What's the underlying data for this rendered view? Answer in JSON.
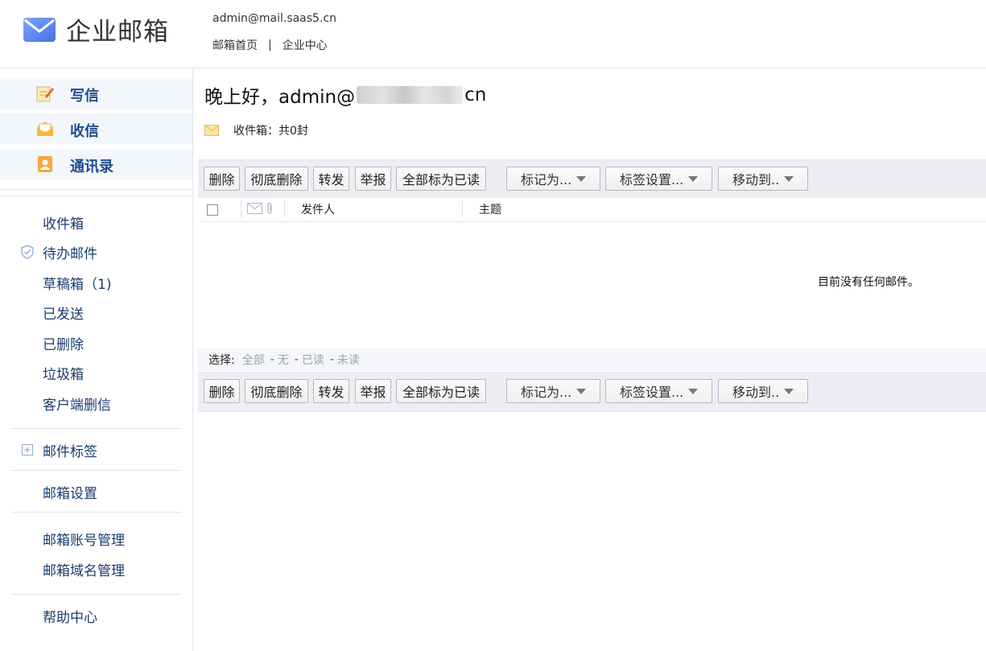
{
  "header": {
    "app_title": "企业邮箱",
    "user_email": "admin@mail.saas5.cn",
    "links": [
      "邮箱首页",
      "企业中心"
    ],
    "separator": "|"
  },
  "sidebar": {
    "quick_actions": [
      {
        "label": "写信",
        "icon": "compose-icon"
      },
      {
        "label": "收信",
        "icon": "receive-icon"
      },
      {
        "label": "通讯录",
        "icon": "contacts-icon"
      }
    ],
    "folders": [
      {
        "label": "收件箱"
      },
      {
        "label": "待办邮件",
        "icon": "todo-shield-icon"
      },
      {
        "label": "草稿箱（1)"
      },
      {
        "label": "已发送"
      },
      {
        "label": "已删除"
      },
      {
        "label": "垃圾箱"
      },
      {
        "label": "客户端删信"
      }
    ],
    "mail_tags": {
      "label": "邮件标签",
      "icon": "plus-square-icon"
    },
    "settings": "邮箱设置",
    "admin_links": [
      "邮箱账号管理",
      "邮箱域名管理"
    ],
    "help": "帮助中心"
  },
  "main": {
    "greeting_prefix": "晚上好，admin@",
    "greeting_suffix": "cn",
    "inbox_summary": "收件箱：共0封",
    "toolbar": {
      "buttons": [
        "删除",
        "彻底删除",
        "转发",
        "举报",
        "全部标为已读"
      ],
      "dropdowns": [
        "标记为...",
        "标签设置...",
        "移动到.."
      ]
    },
    "list_columns": {
      "sender": "发件人",
      "subject": "主题"
    },
    "empty_message": "目前没有任何邮件。",
    "select_bar": {
      "label": "选择:",
      "options": [
        "全部",
        "无",
        "已读",
        "未读"
      ]
    }
  },
  "colors": {
    "sidebar_highlight": "#f3f6fb",
    "nav_text": "#1a3c6e",
    "toolbar_bg": "#eceef3",
    "logo_blue": "#5b8def"
  }
}
